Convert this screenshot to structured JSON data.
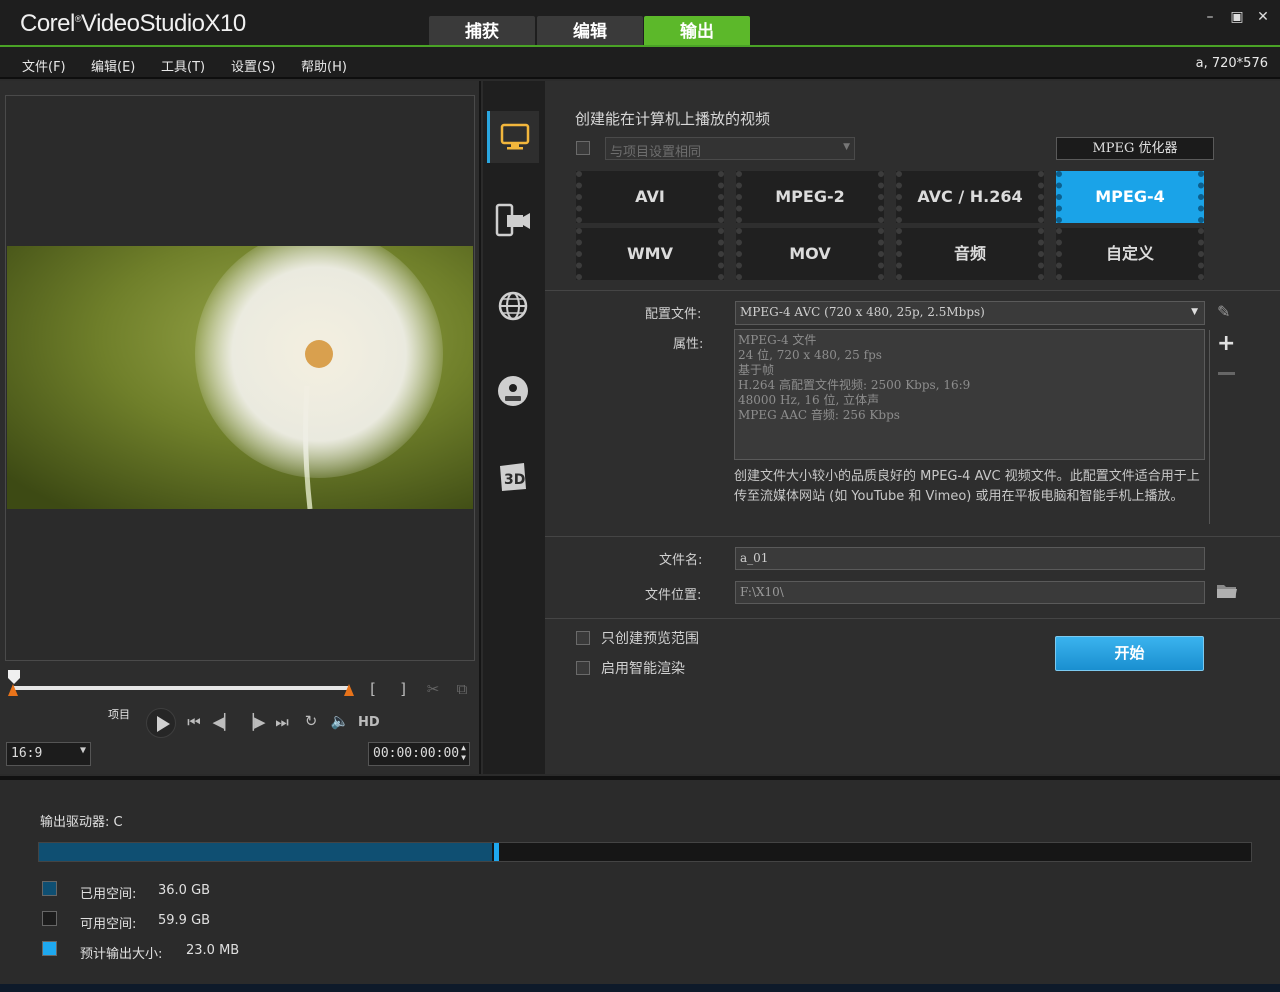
{
  "app": {
    "title_brand": "Corel",
    "title_product": "VideoStudio",
    "title_version": "X10"
  },
  "main_tabs": [
    {
      "label": "捕获",
      "active": false
    },
    {
      "label": "编辑",
      "active": false
    },
    {
      "label": "输出",
      "active": true
    }
  ],
  "window_controls": {
    "minimize": "–",
    "restore": "▣",
    "close": "✕"
  },
  "menu": [
    "文件(F)",
    "编辑(E)",
    "工具(T)",
    "设置(S)",
    "帮助(H)"
  ],
  "project_info": "a, 720*576",
  "preview": {
    "mode_label": "项目",
    "hd_label": "HD",
    "mark_in": "[",
    "mark_out": "]",
    "aspect": "16:9",
    "timecode": "00:00:00:00"
  },
  "output": {
    "heading": "创建能在计算机上播放的视频",
    "same_as_project": "与项目设置相同",
    "mpeg_optimizer": "MPEG 优化器",
    "formats": [
      {
        "label": "AVI",
        "active": false
      },
      {
        "label": "MPEG-2",
        "active": false
      },
      {
        "label": "AVC / H.264",
        "active": false
      },
      {
        "label": "MPEG-4",
        "active": true
      },
      {
        "label": "WMV",
        "active": false
      },
      {
        "label": "MOV",
        "active": false
      },
      {
        "label": "音频",
        "active": false
      },
      {
        "label": "自定义",
        "active": false
      }
    ],
    "profile_label": "配置文件:",
    "profile_value": "MPEG-4 AVC (720 x 480, 25p, 2.5Mbps)",
    "properties_label": "属性:",
    "properties_text": "MPEG-4 文件\n24 位, 720 x 480, 25 fps\n基于帧\nH.264 高配置文件视频: 2500 Kbps, 16:9\n48000 Hz, 16 位, 立体声\nMPEG AAC 音频: 256 Kbps",
    "description": "创建文件大小较小的品质良好的 MPEG-4 AVC 视频文件。此配置文件适合用于上传至流媒体网站 (如 YouTube 和 Vimeo) 或用在平板电脑和智能手机上播放。",
    "filename_label": "文件名:",
    "filename_value": "a_01",
    "location_label": "文件位置:",
    "location_value": "F:\\X10\\",
    "preview_range_only": "只创建预览范围",
    "smart_render": "启用智能渲染",
    "start_label": "开始"
  },
  "drive": {
    "label": "输出驱动器: C",
    "used_fraction": 0.374,
    "output_fraction": 0.0039,
    "used_label": "已用空间:",
    "used_value": "36.0 GB",
    "free_label": "可用空间:",
    "free_value": "59.9 GB",
    "estimate_label": "预计输出大小:",
    "estimate_value": "23.0 MB"
  },
  "colors": {
    "accent_green": "#5cb82a",
    "accent_blue": "#1aa3e8",
    "used_space": "#0f4f72",
    "free_space": "#1c1c1c",
    "output_size": "#1ea8ef"
  }
}
